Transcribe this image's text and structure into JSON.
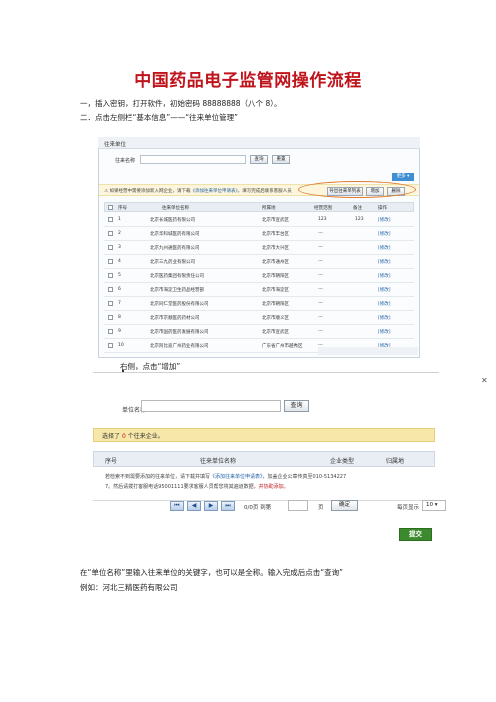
{
  "doc": {
    "title": "中国药品电子监管网操作流程",
    "step1": "一，插入密钥，打开软件，初始密码 88888888（八个 8）。",
    "step2": "二．点击左侧栏“基本信息”——“往来单位管理”",
    "caption_add": "右侧，点击“增加”",
    "instruction": "在“单位名称”里输入往来单位的关键字，也可以是全称。输入完成后点击“查询”",
    "example": "例如：河北三精医药有限公司"
  },
  "shot1": {
    "tab": "往来单位",
    "search_label": "往来名称",
    "query_btn": "查询",
    "reset_btn": "重置",
    "more_btn": "更多 ▾",
    "notice_prefix": "⚠ 如果经营中需要添加新入网企业，请下载",
    "notice_link": "《添加往来单位申请表》",
    "notice_suffix": "，填写完成后联系客服人员",
    "export_btn": "导出往来单列表",
    "add_btn": "增加",
    "delete_btn": "删除",
    "headers": [
      "序号",
      "往来单位名称",
      "所属地",
      "经营范围",
      "备注",
      "操作"
    ],
    "rows": [
      {
        "no": "1",
        "name": "北京长城医药有限公司",
        "region": "北京市宣武区",
        "scope": "123",
        "note": "123",
        "op": "[修改]"
      },
      {
        "no": "2",
        "name": "北京华科城医药有限公司",
        "region": "北京市丰台区",
        "scope": "---",
        "note": "",
        "op": "[修改]"
      },
      {
        "no": "3",
        "name": "北京九州通医药有限公司",
        "region": "北京市大兴区",
        "scope": "---",
        "note": "",
        "op": "[修改]"
      },
      {
        "no": "4",
        "name": "北京三九药业有限公司",
        "region": "北京市通州区",
        "scope": "---",
        "note": "",
        "op": "[修改]"
      },
      {
        "no": "5",
        "name": "北京医药集团有限责任公司",
        "region": "北京市朝阳区",
        "scope": "---",
        "note": "",
        "op": "[修改]"
      },
      {
        "no": "6",
        "name": "北京市海淀卫生药品经营部",
        "region": "北京市海淀区",
        "scope": "---",
        "note": "",
        "op": "[修改]"
      },
      {
        "no": "7",
        "name": "北京同仁堂医药股份有限公司",
        "region": "北京市朝阳区",
        "scope": "---",
        "note": "",
        "op": "[修改]"
      },
      {
        "no": "8",
        "name": "北京市京顺医药药材公司",
        "region": "北京市顺义区",
        "scope": "---",
        "note": "",
        "op": "[修改]"
      },
      {
        "no": "9",
        "name": "北京市国药医药发展有限公司",
        "region": "北京市宣武区",
        "scope": "---",
        "note": "",
        "op": "[修改]"
      },
      {
        "no": "10",
        "name": "北京阿比迪广州药业有限公司",
        "region": "广东省广州市越秀区",
        "scope": "---",
        "note": "",
        "op": "[修改]"
      }
    ]
  },
  "shot2": {
    "close": "✕",
    "unit_label": "单位名称",
    "query_btn": "查询",
    "selected_prefix": "选择了",
    "selected_count": "0",
    "selected_suffix": "个往来企业。",
    "headers": [
      "序号",
      "往来单位名称",
      "企业类型",
      "归属地"
    ],
    "info1_prefix": "若检索不到需要添加的往来单位，请下载并填写",
    "info1_link": "《添加往来单位申请表》",
    "info1_suffix": "，加盖企业公章传真至010-5134227",
    "info2_prefix": "7。然后请拨打客服电话95001111要求客服人员帮您将其遍道数据",
    "info2_red": "，并协助添加。",
    "page_status": "0/0页 到第",
    "page_unit": "页",
    "confirm_btn": "确定",
    "page_size_label": "每页显示",
    "page_size": "10",
    "submit_btn": "提交"
  },
  "colors": {
    "title_red": "#c0141c",
    "link_blue": "#1d5fa8",
    "highlight_orange": "#e07b2a",
    "notice_yellow": "#f7e7a8",
    "submit_green": "#3c8a2e"
  }
}
